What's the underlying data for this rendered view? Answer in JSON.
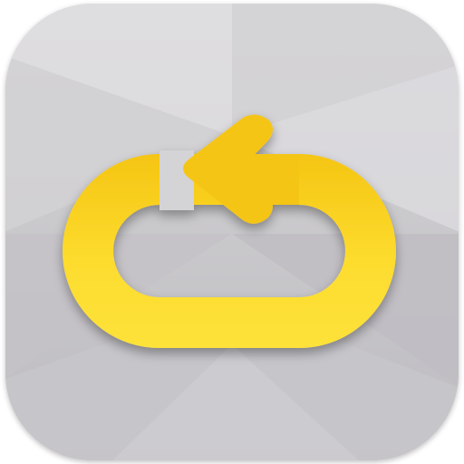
{
  "icon": {
    "name": "loop-repeat-icon",
    "colors": {
      "tile_light": "#d8d7d9",
      "tile_mid": "#c9c8cb",
      "tile_dark": "#bdbbc0",
      "facet_light": "#e3e2e4",
      "facet_dark": "#b3b1b6",
      "symbol_yellow": "#fde23a",
      "symbol_yellow_deep": "#f5c513",
      "symbol_yellow_edge": "#e6ae0c"
    }
  }
}
